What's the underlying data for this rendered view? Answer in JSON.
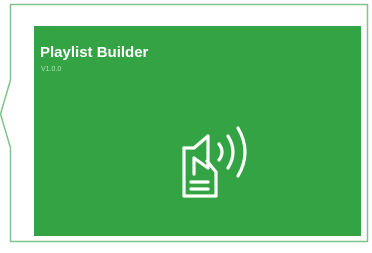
{
  "tile": {
    "title": "Playlist Builder",
    "version": "V1.0.0",
    "background_color": "#33a343",
    "icon": "playlist-speaker-icon"
  },
  "callout": {
    "border_color": "#7fc489"
  }
}
